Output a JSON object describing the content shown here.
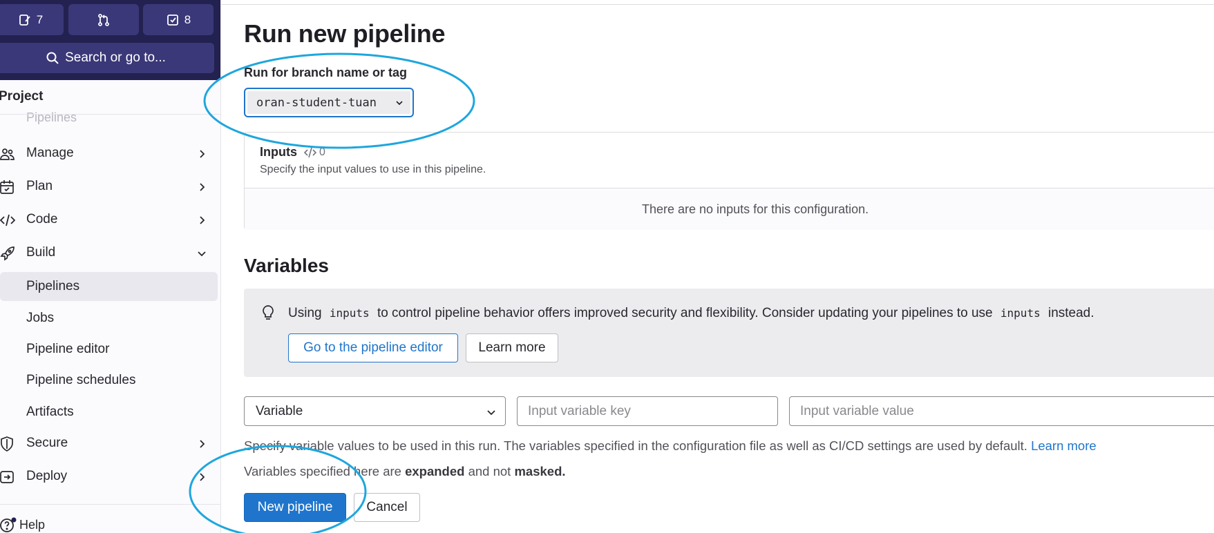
{
  "sidebar": {
    "top_buttons": [
      {
        "icon": "issues-icon",
        "count": "7"
      },
      {
        "icon": "merge-request-icon",
        "count": ""
      },
      {
        "icon": "todo-icon",
        "count": "8"
      }
    ],
    "search_label": "Search or go to...",
    "project_label": "Project",
    "ghost_item": "Pipelines",
    "items": [
      {
        "label": "Manage",
        "icon": "users-icon",
        "chevron": "right"
      },
      {
        "label": "Plan",
        "icon": "calendar-icon",
        "chevron": "right"
      },
      {
        "label": "Code",
        "icon": "code-icon",
        "chevron": "right"
      },
      {
        "label": "Build",
        "icon": "rocket-icon",
        "chevron": "down"
      },
      {
        "label": "Pipelines",
        "sub": true,
        "active": true
      },
      {
        "label": "Jobs",
        "sub": true
      },
      {
        "label": "Pipeline editor",
        "sub": true
      },
      {
        "label": "Pipeline schedules",
        "sub": true
      },
      {
        "label": "Artifacts",
        "sub": true
      },
      {
        "label": "Secure",
        "icon": "shield-icon",
        "chevron": "right"
      },
      {
        "label": "Deploy",
        "icon": "deploy-icon",
        "chevron": "right"
      }
    ],
    "help_label": "Help"
  },
  "main": {
    "title": "Run new pipeline",
    "branch_label": "Run for branch name or tag",
    "branch_value": "oran-student-tuan",
    "inputs": {
      "title": "Inputs",
      "count": "0",
      "description": "Specify the input values to use in this pipeline.",
      "empty": "There are no inputs for this configuration."
    },
    "variables_title": "Variables",
    "alert": {
      "text_1": "Using",
      "code_1": "inputs",
      "text_2": "to control pipeline behavior offers improved security and flexibility. Consider updating your pipelines to use",
      "code_2": "inputs",
      "text_3": "instead.",
      "button_editor": "Go to the pipeline editor",
      "button_learn": "Learn more"
    },
    "variable_row": {
      "type": "Variable",
      "key_placeholder": "Input variable key",
      "value_placeholder": "Input variable value"
    },
    "help_text": "Specify variable values to be used in this run. The variables specified in the configuration file as well as CI/CD settings are used by default.",
    "help_link": "Learn more",
    "expand_1": "Variables specified here are",
    "expand_bold_1": "expanded",
    "expand_2": "and not",
    "expand_bold_2": "masked.",
    "submit_label": "New pipeline",
    "cancel_label": "Cancel"
  },
  "colors": {
    "sidebar_top": "#232150",
    "primary": "#1f75cb",
    "annotation": "#1ea6dd"
  }
}
